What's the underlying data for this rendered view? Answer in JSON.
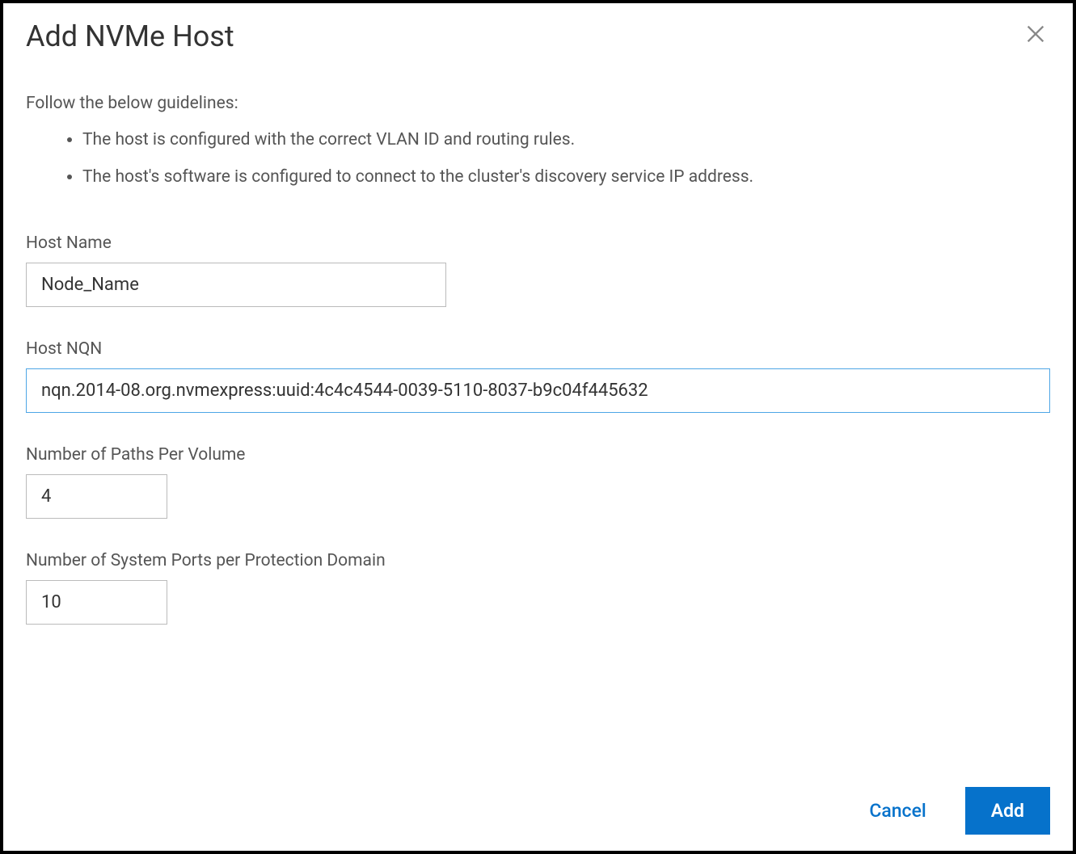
{
  "dialog": {
    "title": "Add NVMe Host",
    "guidelines_intro": "Follow the below guidelines:",
    "guidelines": [
      "The host is configured with the correct VLAN ID and routing rules.",
      "The host's software is configured to connect to the cluster's discovery service IP address."
    ],
    "fields": {
      "host_name": {
        "label": "Host Name",
        "value": "Node_Name"
      },
      "host_nqn": {
        "label": "Host NQN",
        "value": "nqn.2014-08.org.nvmexpress:uuid:4c4c4544-0039-5110-8037-b9c04f445632"
      },
      "paths_per_volume": {
        "label": "Number of Paths Per Volume",
        "value": "4"
      },
      "system_ports": {
        "label": "Number of System Ports per Protection Domain",
        "value": "10"
      }
    },
    "footer": {
      "cancel_label": "Cancel",
      "add_label": "Add"
    }
  }
}
